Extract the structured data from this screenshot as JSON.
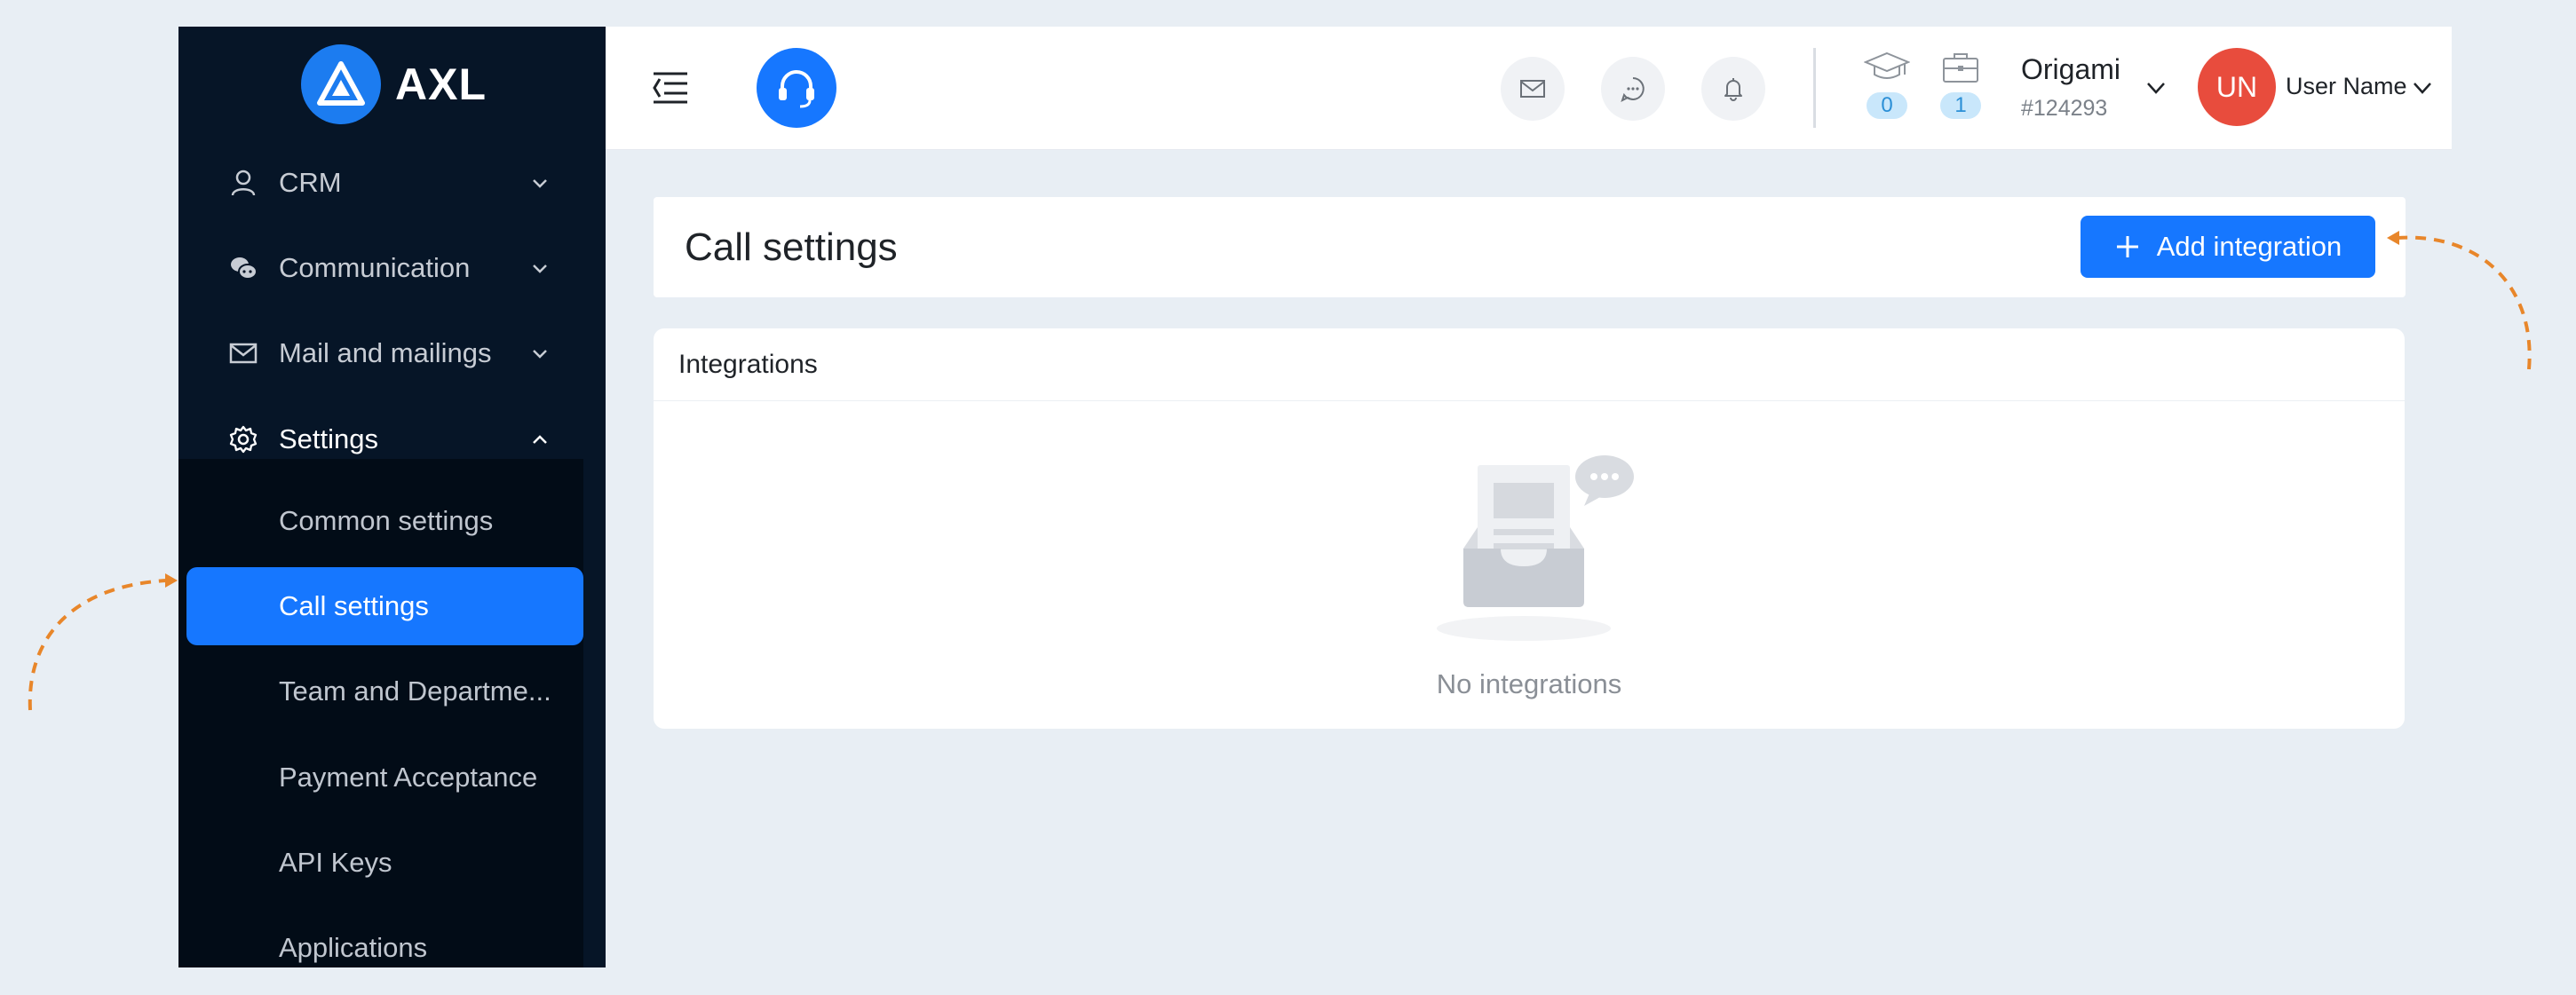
{
  "brand": {
    "name": "AXL"
  },
  "sidebar": {
    "items": [
      {
        "label": "CRM",
        "icon": "user-icon"
      },
      {
        "label": "Communication",
        "icon": "chat-bubbles-icon"
      },
      {
        "label": "Mail and mailings",
        "icon": "mail-icon"
      },
      {
        "label": "Settings",
        "icon": "gear-icon",
        "open": true
      }
    ],
    "sub_items": [
      {
        "label": "Common settings"
      },
      {
        "label": "Call settings",
        "active": true
      },
      {
        "label": "Team and Departme..."
      },
      {
        "label": "Payment Acceptance"
      },
      {
        "label": "API Keys"
      },
      {
        "label": "Applications"
      }
    ]
  },
  "header": {
    "stats": [
      {
        "icon": "graduation-cap-icon",
        "count": "0"
      },
      {
        "icon": "briefcase-icon",
        "count": "1"
      }
    ],
    "account": {
      "name": "Origami",
      "id": "#124293"
    },
    "user": {
      "initials": "UN",
      "name": "User Name"
    }
  },
  "main": {
    "title": "Call settings",
    "add_button": "Add integration",
    "integrations": {
      "title": "Integrations",
      "empty_text": "No integrations"
    }
  },
  "colors": {
    "accent": "#1677ff",
    "sidebar_bg": "#061527",
    "avatar": "#e84c3d",
    "annotation_arrow": "#e8862a"
  }
}
